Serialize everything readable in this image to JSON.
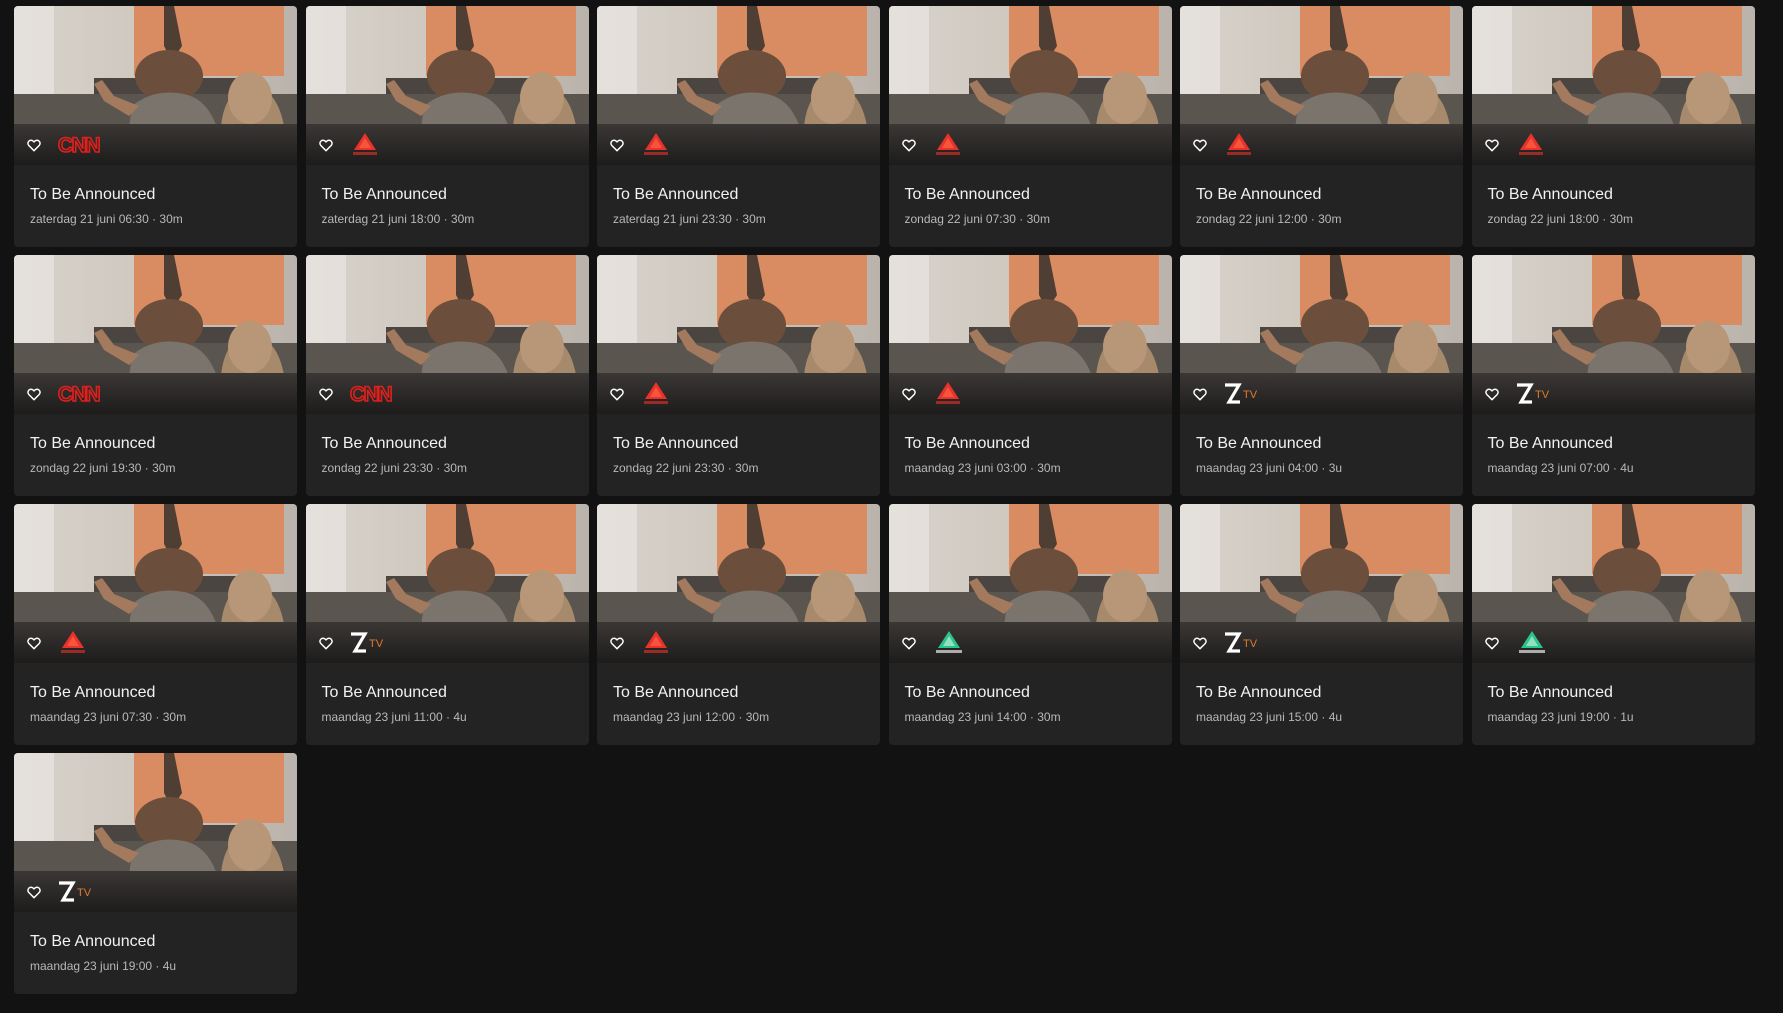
{
  "colors": {
    "background": "#121212",
    "card": "#232323",
    "title": "#f2f2f2",
    "meta": "#b8b8b8",
    "cnn_red": "#e0201c",
    "utsav_plus_red": "#e8322a",
    "utsav_bharat_green": "#2bc48a",
    "ztv_orange": "#e07a2a"
  },
  "programs": [
    {
      "title": "To Be Announced",
      "meta": "zaterdag 21 juni 06:30 · 30m",
      "channel": "cnn"
    },
    {
      "title": "To Be Announced",
      "meta": "zaterdag 21 juni 18:00 · 30m",
      "channel": "utsav-plus"
    },
    {
      "title": "To Be Announced",
      "meta": "zaterdag 21 juni 23:30 · 30m",
      "channel": "utsav-plus"
    },
    {
      "title": "To Be Announced",
      "meta": "zondag 22 juni 07:30 · 30m",
      "channel": "utsav-plus"
    },
    {
      "title": "To Be Announced",
      "meta": "zondag 22 juni 12:00 · 30m",
      "channel": "utsav-plus"
    },
    {
      "title": "To Be Announced",
      "meta": "zondag 22 juni 18:00 · 30m",
      "channel": "utsav-plus"
    },
    {
      "title": "To Be Announced",
      "meta": "zondag 22 juni 19:30 · 30m",
      "channel": "cnn"
    },
    {
      "title": "To Be Announced",
      "meta": "zondag 22 juni 23:30 · 30m",
      "channel": "cnn"
    },
    {
      "title": "To Be Announced",
      "meta": "zondag 22 juni 23:30 · 30m",
      "channel": "utsav-plus"
    },
    {
      "title": "To Be Announced",
      "meta": "maandag 23 juni 03:00 · 30m",
      "channel": "utsav-plus"
    },
    {
      "title": "To Be Announced",
      "meta": "maandag 23 juni 04:00 · 3u",
      "channel": "ztv"
    },
    {
      "title": "To Be Announced",
      "meta": "maandag 23 juni 07:00 · 4u",
      "channel": "ztv"
    },
    {
      "title": "To Be Announced",
      "meta": "maandag 23 juni 07:30 · 30m",
      "channel": "utsav-plus"
    },
    {
      "title": "To Be Announced",
      "meta": "maandag 23 juni 11:00 · 4u",
      "channel": "ztv"
    },
    {
      "title": "To Be Announced",
      "meta": "maandag 23 juni 12:00 · 30m",
      "channel": "utsav-plus"
    },
    {
      "title": "To Be Announced",
      "meta": "maandag 23 juni 14:00 · 30m",
      "channel": "utsav-bharat"
    },
    {
      "title": "To Be Announced",
      "meta": "maandag 23 juni 15:00 · 4u",
      "channel": "ztv"
    },
    {
      "title": "To Be Announced",
      "meta": "maandag 23 juni 19:00 · 1u",
      "channel": "utsav-bharat"
    },
    {
      "title": "To Be Announced",
      "meta": "maandag 23 juni 19:00 · 4u",
      "channel": "ztv"
    }
  ],
  "channel_logos": {
    "cnn": {
      "text": "CNN",
      "icon": "cnn-logo"
    },
    "utsav-plus": {
      "text": "Utsav Plus",
      "icon": "utsav-plus-logo"
    },
    "utsav-bharat": {
      "text": "Utsav Bharat",
      "icon": "utsav-bharat-logo"
    },
    "ztv": {
      "text": "ZTV",
      "icon": "ztv-logo"
    }
  },
  "favorite_icon": "heart-outline-icon"
}
